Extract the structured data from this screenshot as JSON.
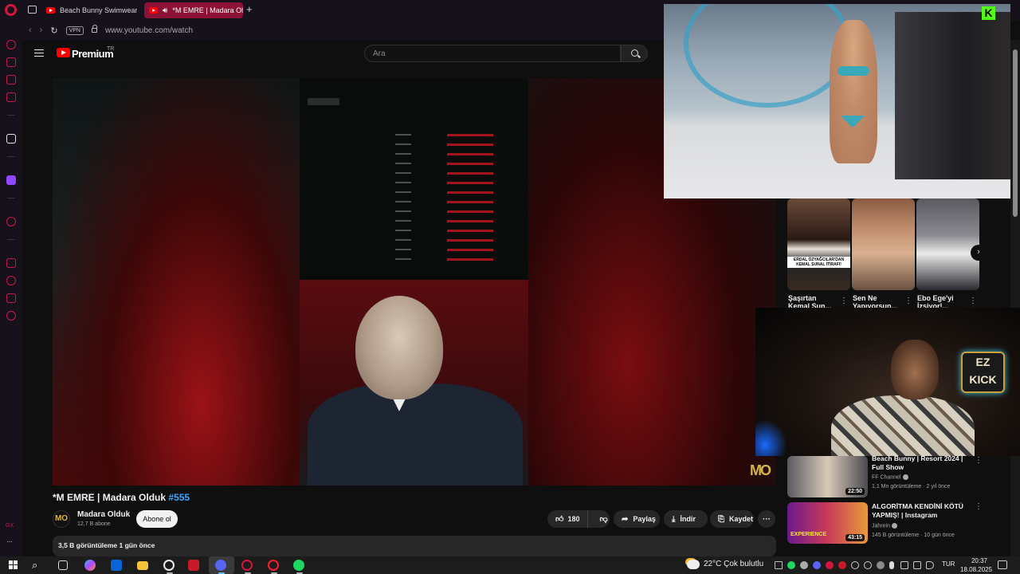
{
  "browser": {
    "tabs": [
      {
        "label": "Beach Bunny Swimwear F"
      },
      {
        "label": "*M EMRE | Madara Ol"
      }
    ],
    "new_tab_glyph": "+",
    "vpn_label": "VPN",
    "url": "www.youtube.com/watch"
  },
  "sidebar": {
    "bottom_label": "GX"
  },
  "youtube": {
    "brand": "Premium",
    "region": "TR",
    "search_placeholder": "Ara"
  },
  "video": {
    "title": "*M EMRE | Madara Olduk",
    "hashtag": "#555",
    "channel_name": "Madara Olduk",
    "channel_subs": "12,7 B abone",
    "channel_avatar_text": "MO",
    "subscribe_label": "Abone ol",
    "likes": "180",
    "share_label": "Paylaş",
    "download_label": "İndir",
    "save_label": "Kaydet",
    "description_meta": "3,5 B görüntüleme  1 gün önce",
    "watermark": "MO"
  },
  "shorts": [
    {
      "title": "Şaşırtan Kemal Sun...",
      "caption": "ERDAL ÖZYAĞCILAR'DAN KEMAL SUNAL İTİRAFI!"
    },
    {
      "title": "Sen Ne Yapıyorsun..."
    },
    {
      "title": "Ebo Ege'yi İzsiyor!..."
    }
  ],
  "overlays": {
    "kick_logo": "K",
    "ez_kick_top": "EZ",
    "ez_kick_bottom": "KICK"
  },
  "related": [
    {
      "title": "Beach Bunny | Resort 2024 | Full Show",
      "channel": "FF Channel",
      "meta": "1,1 Mn görüntüleme · 2 yıl önce",
      "duration": "22:50"
    },
    {
      "title": "ALGORİTMA KENDİNİ KÖTÜ YAPMIŞ! | Instagram Experien...",
      "channel": "Jahrein",
      "meta": "145 B görüntüleme · 10 gün önce",
      "duration": "43:15",
      "thumb_text": "EXPERIENCE"
    }
  ],
  "taskbar": {
    "weather": "22°C  Çok bulutlu",
    "language": "TUR",
    "time": "20:37",
    "date": "18.08.2025"
  },
  "colors": {
    "opera_red": "#d2163d",
    "youtube_red": "#ff0000",
    "kick_green": "#53fc18",
    "link_blue": "#3ea6ff"
  }
}
